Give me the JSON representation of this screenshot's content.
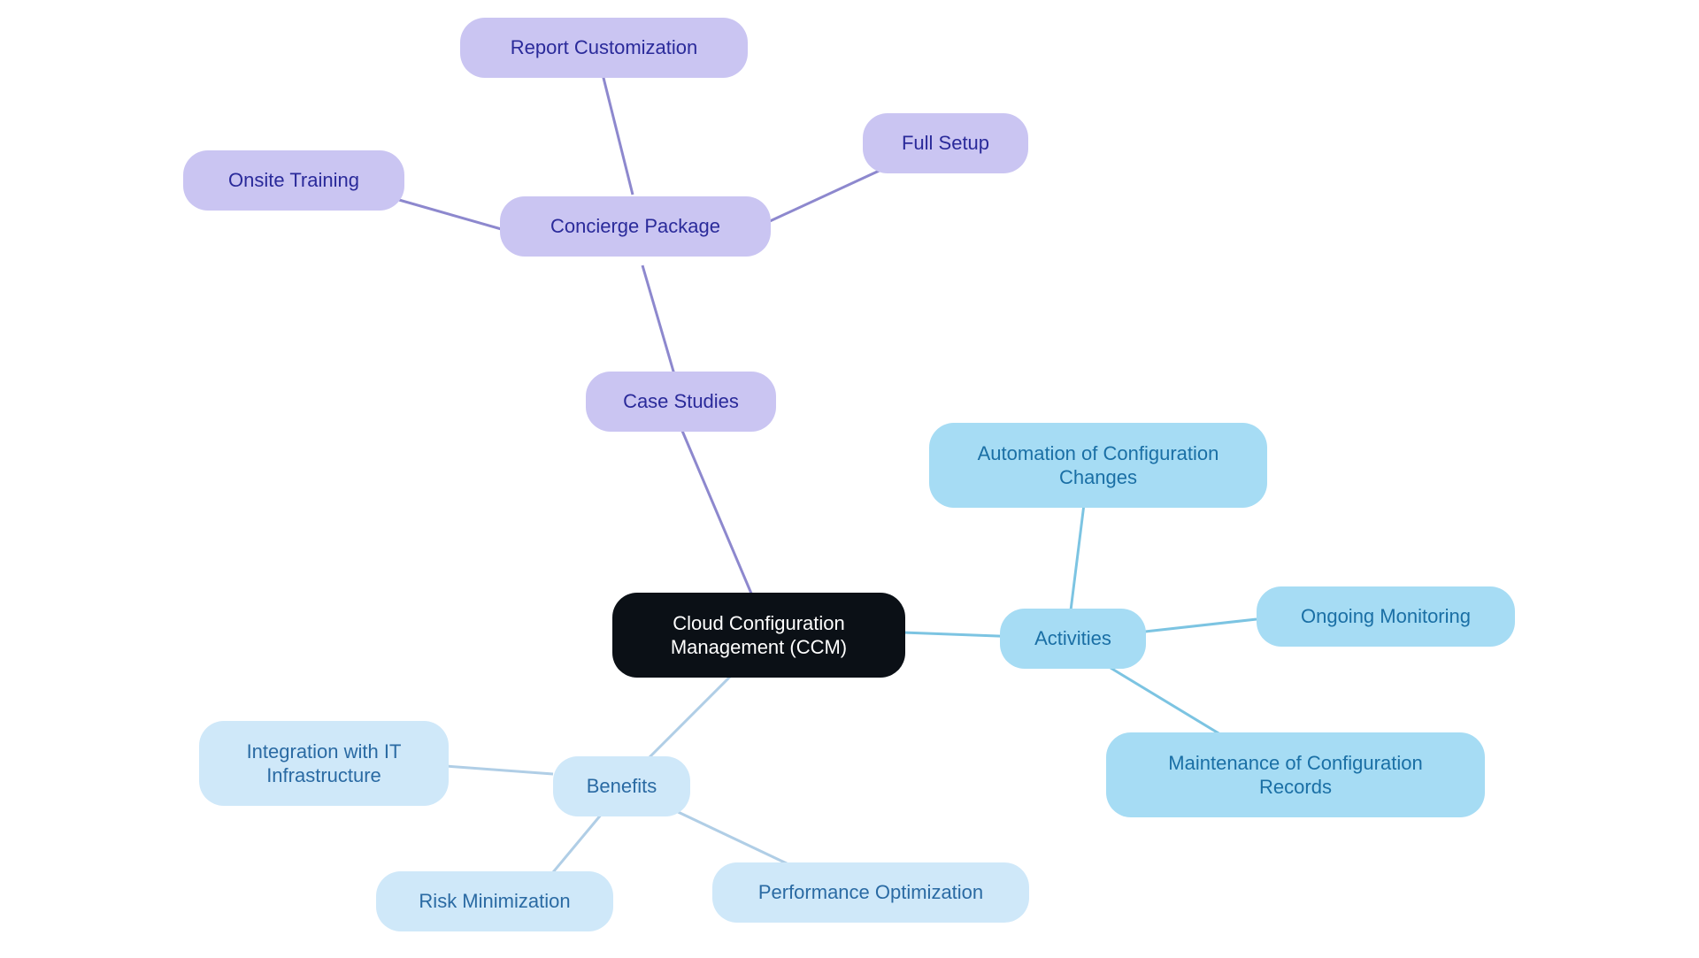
{
  "colors": {
    "root_bg": "#0b1016",
    "root_text": "#ffffff",
    "purple_bg": "#cac5f2",
    "purple_text": "#2a2a9a",
    "blue_dark_bg": "#a6dcf4",
    "blue_dark_text": "#1a6fa5",
    "blue_light_bg": "#cfe8f9",
    "blue_light_text": "#2a6aa3",
    "edge_purple": "#8d88ce",
    "edge_blue_dark": "#7cc4e2",
    "edge_blue_light": "#b0cee6"
  },
  "nodes": {
    "root": {
      "label": "Cloud Configuration Management (CCM)"
    },
    "case_studies": {
      "label": "Case Studies"
    },
    "concierge": {
      "label": "Concierge Package"
    },
    "report_custom": {
      "label": "Report Customization"
    },
    "onsite_training": {
      "label": "Onsite Training"
    },
    "full_setup": {
      "label": "Full Setup"
    },
    "activities": {
      "label": "Activities"
    },
    "automation": {
      "label": "Automation of Configuration Changes"
    },
    "ongoing_monitoring": {
      "label": "Ongoing Monitoring"
    },
    "maintenance_records": {
      "label": "Maintenance of Configuration Records"
    },
    "benefits": {
      "label": "Benefits"
    },
    "integration_it": {
      "label": "Integration with IT Infrastructure"
    },
    "risk_min": {
      "label": "Risk Minimization"
    },
    "perf_opt": {
      "label": "Performance Optimization"
    }
  }
}
